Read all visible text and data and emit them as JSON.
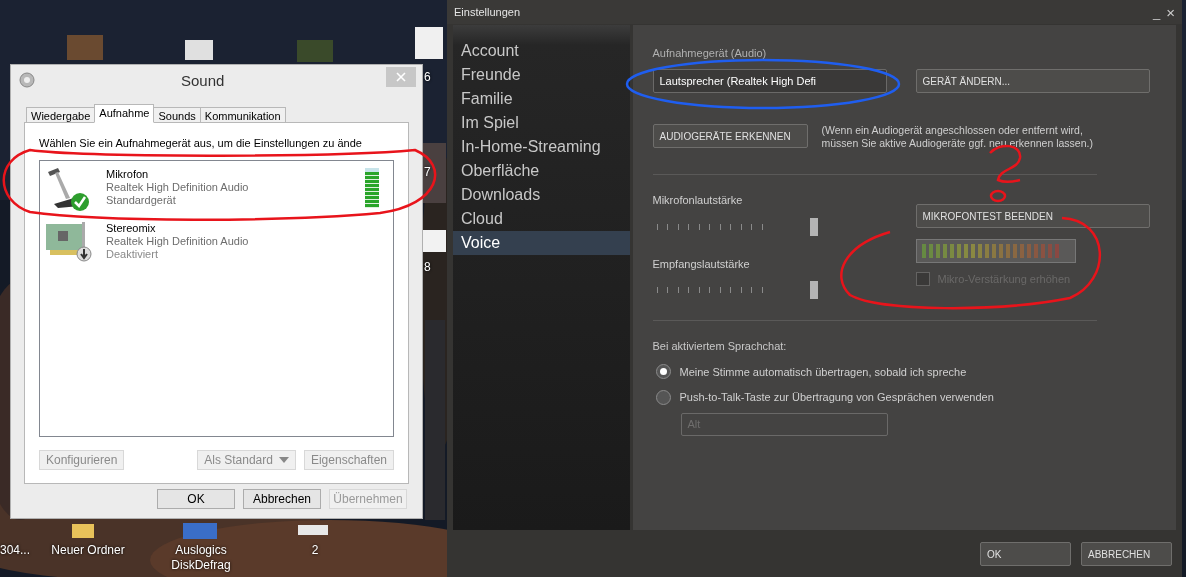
{
  "desktop": {
    "icons": [
      {
        "label": "304..."
      },
      {
        "label": "Neuer Ordner"
      },
      {
        "label": "Auslogics DiskDefrag"
      },
      {
        "label": "2"
      }
    ],
    "edge_labels": [
      "6",
      "7",
      "8"
    ]
  },
  "sound_window": {
    "title": "Sound",
    "tabs": [
      {
        "label": "Wiedergabe",
        "selected": false
      },
      {
        "label": "Aufnahme",
        "selected": true
      },
      {
        "label": "Sounds",
        "selected": false
      },
      {
        "label": "Kommunikation",
        "selected": false
      }
    ],
    "instruction": "Wählen Sie ein Aufnahmegerät aus, um die Einstellungen zu ände",
    "devices": [
      {
        "kind": "microphone",
        "name": "Mikrofon",
        "driver": "Realtek High Definition Audio",
        "status": "Standardgerät",
        "is_default": true,
        "level": 0.9
      },
      {
        "kind": "sound_card",
        "name": "Stereomix",
        "driver": "Realtek High Definition Audio",
        "status": "Deaktiviert",
        "is_default": false
      }
    ],
    "device_buttons": [
      {
        "label": "Konfigurieren",
        "kind": "plain",
        "disabled": true
      },
      {
        "label": "Als Standard",
        "kind": "split",
        "disabled": true
      },
      {
        "label": "Eigenschaften",
        "kind": "plain",
        "disabled": true
      }
    ],
    "dialog_buttons": [
      {
        "label": "OK",
        "disabled": false
      },
      {
        "label": "Abbrechen",
        "disabled": false
      },
      {
        "label": "Übernehmen",
        "disabled": true
      }
    ]
  },
  "settings_window": {
    "title": "Einstellungen",
    "minimize": "_",
    "close": "×",
    "sidebar": [
      {
        "label": "Account",
        "selected": false
      },
      {
        "label": "Freunde",
        "selected": false
      },
      {
        "label": "Familie",
        "selected": false
      },
      {
        "label": "Im Spiel",
        "selected": false
      },
      {
        "label": "In-Home-Streaming",
        "selected": false
      },
      {
        "label": "Oberfläche",
        "selected": false
      },
      {
        "label": "Downloads",
        "selected": false
      },
      {
        "label": "Cloud",
        "selected": false
      },
      {
        "label": "Voice",
        "selected": true
      }
    ],
    "recording_device_label": "Aufnahmegerät (Audio)",
    "recording_device": "Lautsprecher (Realtek High Defi",
    "change_device_button": "GERÄT ÄNDERN...",
    "detect_button": "AUDIOGERÄTE ERKENNEN",
    "detect_note": "(Wenn ein Audiogerät angeschlossen oder entfernt wird, müssen Sie aktive Audiogeräte ggf. neu erkennen lassen.)",
    "mic_volume": {
      "label": "Mikrofonlautstärke",
      "level": 1
    },
    "mic_test_button": "MIKROFONTEST BEENDEN",
    "receive_volume": {
      "label": "Empfangslautstärke",
      "level": 1
    },
    "boost": {
      "label": "Mikro-Verstärkung erhöhen",
      "checked": false,
      "disabled": true
    },
    "voice_chat_label": "Bei aktiviertem Sprachchat:",
    "voice_modes": [
      {
        "label": "Meine Stimme automatisch übertragen, sobald ich spreche",
        "selected": true
      },
      {
        "label": "Push-to-Talk-Taste zur Übertragung von Gesprächen verwenden",
        "selected": false
      }
    ],
    "push_to_talk_key": {
      "value": "Alt",
      "disabled": true
    },
    "footer_buttons": [
      "OK",
      "ABBRECHEN"
    ]
  }
}
